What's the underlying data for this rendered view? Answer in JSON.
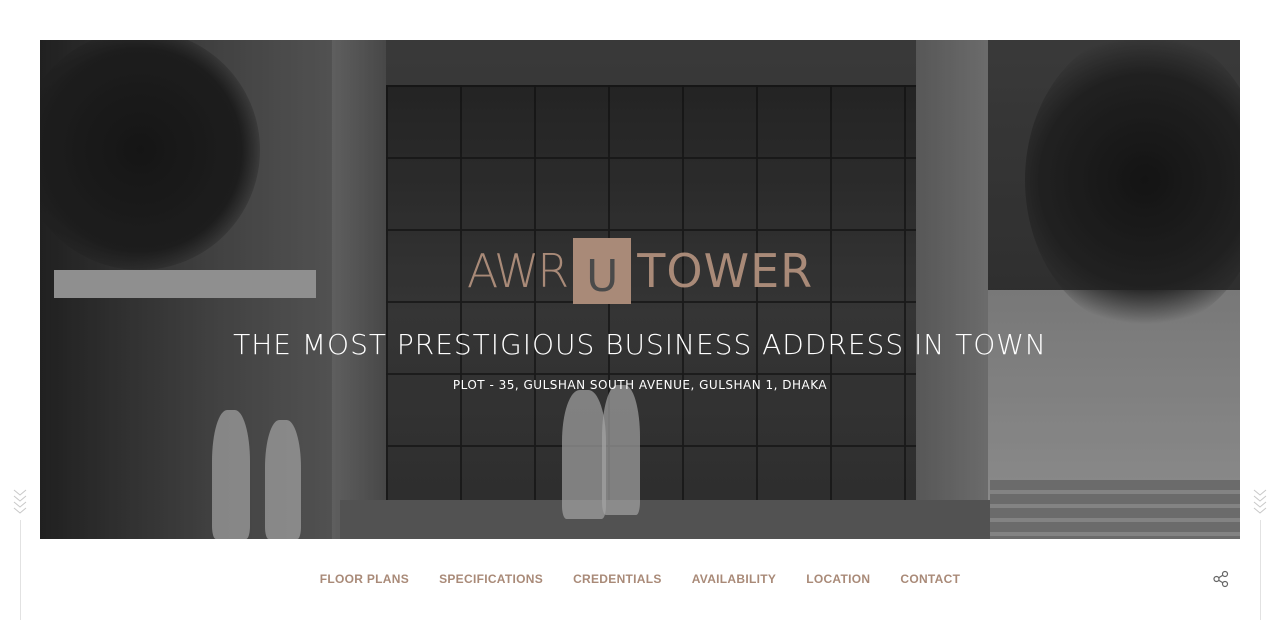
{
  "hero": {
    "logo": {
      "left": "AWR",
      "box": "U",
      "right": "TOWER"
    },
    "tagline": "THE MOST PRESTIGIOUS BUSINESS ADDRESS IN TOWN",
    "address": "PLOT - 35, GULSHAN SOUTH AVENUE, GULSHAN 1, DHAKA"
  },
  "nav": {
    "items": [
      {
        "label": "FLOOR PLANS"
      },
      {
        "label": "SPECIFICATIONS"
      },
      {
        "label": "CREDENTIALS"
      },
      {
        "label": "AVAILABILITY"
      },
      {
        "label": "LOCATION"
      },
      {
        "label": "CONTACT"
      }
    ]
  },
  "icons": {
    "share": "share-icon",
    "scroll": "chevron-down-icon"
  },
  "colors": {
    "accent": "#a98a78",
    "text_light": "#ffffff"
  }
}
